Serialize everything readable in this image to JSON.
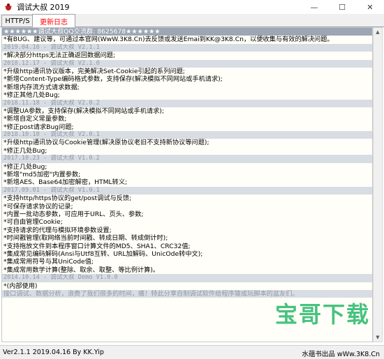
{
  "window": {
    "title": "调试大叔 2019",
    "minimize_glyph": "—",
    "maximize_glyph": "☐",
    "close_glyph": "✕"
  },
  "tabs": [
    {
      "label": "HTTP/S"
    },
    {
      "label": "更新日志",
      "active": true,
      "color": "#ff0000"
    }
  ],
  "log": {
    "rows": [
      {
        "type": "header",
        "text": "★★★★★★调试大叔QQ交流群: 8625678★★★★★★"
      },
      {
        "type": "text",
        "text": "*有BUG、建议等，可通过本官网(WwW.3K8.Cn)去反馈或发送Emai到KK@3K8.Cn，以便收集与有效的解决问题。"
      },
      {
        "type": "ver",
        "text": "2019.04.16 - 调试大叔 V2.1.1"
      },
      {
        "type": "text",
        "text": "*解决部分https无法正确返回数据问题;"
      },
      {
        "type": "ver",
        "text": "2018.12.17 - 调试大叔 V2.1.0"
      },
      {
        "type": "text",
        "text": "*升级http通讯协议版本，完美解决Set-Cookie引起的系列问题;"
      },
      {
        "type": "text",
        "text": "*新增Content-Type编码格式参数，支持保存(解决模拟不同网站或手机请求);"
      },
      {
        "type": "text",
        "text": "*新增内存流方式请求数据;"
      },
      {
        "type": "text",
        "text": "*修正其他几处Bug;"
      },
      {
        "type": "ver",
        "text": "2018.11.18 - 调试大叔 V2.0.2"
      },
      {
        "type": "text",
        "text": "*调整UA参数，支持保存(解决模拟不同网站或手机请求);"
      },
      {
        "type": "text",
        "text": "*新增自定义常量参数;"
      },
      {
        "type": "text",
        "text": "*修正post请求Bug问题;"
      },
      {
        "type": "ver",
        "text": "2018.10.10 - 调试大叔 V2.0.1"
      },
      {
        "type": "text",
        "text": "*升级http通讯协议与Cookie管理(解决原协议老旧不支持新协议等问题);"
      },
      {
        "type": "text",
        "text": "*修正几处Bug;"
      },
      {
        "type": "ver",
        "text": "2017.10.23 - 调试大叔 V1.0.2"
      },
      {
        "type": "text",
        "text": "*修正几处Bug;"
      },
      {
        "type": "text",
        "text": "*新增\"md5加密\"内置参数;"
      },
      {
        "type": "text",
        "text": "*新增AES、Base64加密解密，HTML转义;"
      },
      {
        "type": "ver",
        "text": "2017.09.01 - 调试大叔 V1.0.1"
      },
      {
        "type": "text",
        "text": "*支持http/https协议的get/post调试与反馈;"
      },
      {
        "type": "text",
        "text": "*可保存请求协议的记录;"
      },
      {
        "type": "text",
        "text": "*内置一批动态参数，可应用于URL、页头、参数;"
      },
      {
        "type": "text",
        "text": "*可自由管理Cookie;"
      },
      {
        "type": "text",
        "text": "*支持请求的代理与模拟环境参数设置;"
      },
      {
        "type": "text",
        "text": "*时间戳管理(取网络当前时间戳、转成日期、转成倒计时);"
      },
      {
        "type": "text",
        "text": "*支持拖放文件到本程序窗口计算文件的MD5、SHA1、CRC32值;"
      },
      {
        "type": "text",
        "text": "*集成常见编码解码(Ansi与Utf8互转、URL加解码、UnicOde转中文);"
      },
      {
        "type": "text",
        "text": "*集成常用符号与其UniCode值;"
      },
      {
        "type": "text",
        "text": "*集成常用数学计算(整除、取余、取整、等比例计算)。"
      },
      {
        "type": "ver",
        "text": "2014.10.14 - 调试大叔 Demo  V1.0.0"
      },
      {
        "type": "text",
        "text": "*(内部使用)"
      },
      {
        "type": "last-note",
        "text": "接口调试、数据分析，浪费了我们很多的时间，痛！特此分享自制调试软件给程序猿或玩脚本的盆友们。"
      }
    ]
  },
  "watermark": {
    "text": "宝哥下载",
    "color": "#00aa50"
  },
  "status": {
    "left": "Ver2.1.1 2019.04.16 By KK.Yip",
    "right": "水蕴书出品 wWw.3K8.Cn"
  },
  "icons": {
    "app": "bug-app-icon",
    "scroll_up": "scroll-up-arrow-icon",
    "scroll_down": "scroll-down-arrow-icon"
  }
}
